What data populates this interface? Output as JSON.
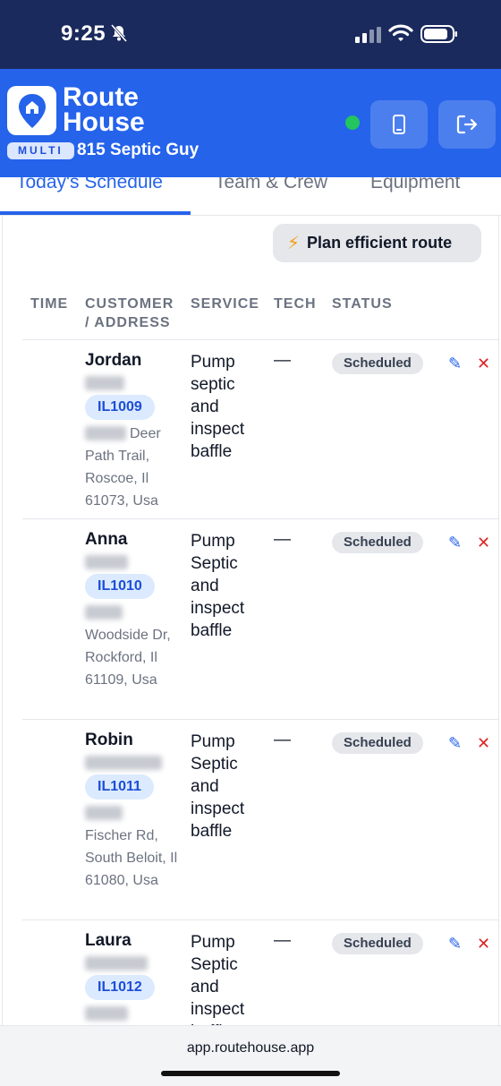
{
  "status_bar": {
    "time": "9:25"
  },
  "header": {
    "brand_line1": "Route",
    "brand_line2": "House",
    "plan_badge": "MULTI",
    "company_name": "815 Septic Guy",
    "online_color": "#22c55e",
    "accent_color": "#2563eb"
  },
  "tabs": [
    {
      "label": "Today's Schedule",
      "active": true
    },
    {
      "label": "Team & Crew",
      "active": false
    },
    {
      "label": "Equipment",
      "active": false
    }
  ],
  "actions": {
    "plan_route_label": "Plan efficient route"
  },
  "table": {
    "columns": [
      "TIME",
      "CUSTOMER / ADDRESS",
      "SERVICE",
      "TECH",
      "STATUS"
    ],
    "rows": [
      {
        "name": "Jordan",
        "account": "IL1009",
        "address": "Deer Path Trail, Roscoe, Il 61073, Usa",
        "service": "Pump septic and inspect baffle",
        "tech": "—",
        "status": "Scheduled"
      },
      {
        "name": "Anna",
        "account": "IL1010",
        "address": "Woodside Dr, Rockford, Il 61109, Usa",
        "service": "Pump Septic and inspect baffle",
        "tech": "—",
        "status": "Scheduled"
      },
      {
        "name": "Robin",
        "account": "IL1011",
        "address": "Fischer Rd, South Beloit, Il 61080, Usa",
        "service": "Pump Septic and inspect baffle",
        "tech": "—",
        "status": "Scheduled"
      },
      {
        "name": "Laura",
        "account": "IL1012",
        "address": "",
        "service": "Pump Septic and inspect baffle",
        "tech": "—",
        "status": "Scheduled"
      }
    ]
  },
  "browser": {
    "url": "app.routehouse.app"
  }
}
